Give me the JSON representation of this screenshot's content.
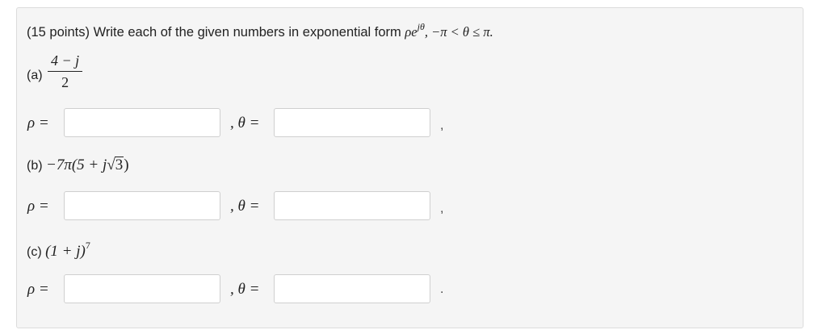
{
  "question": {
    "points": "(15 points)",
    "text": "Write each of the given numbers in exponential form",
    "form_base": "ρe",
    "form_exp": "jθ",
    "range": ", −π < θ ≤ π."
  },
  "parts": [
    {
      "label": "(a)",
      "numerator": "4 − j",
      "denominator": "2",
      "rho_label": "ρ =",
      "theta_label": ", θ =",
      "trailing": ","
    },
    {
      "label": "(b)",
      "expr_prefix": "−7π(5 + j",
      "sqrt_content": "3",
      "expr_suffix": ")",
      "rho_label": "ρ =",
      "theta_label": ", θ =",
      "trailing": ","
    },
    {
      "label": "(c)",
      "expr_base": "(1 + j)",
      "expr_exp": "7",
      "rho_label": "ρ =",
      "theta_label": ", θ =",
      "trailing": "."
    }
  ]
}
